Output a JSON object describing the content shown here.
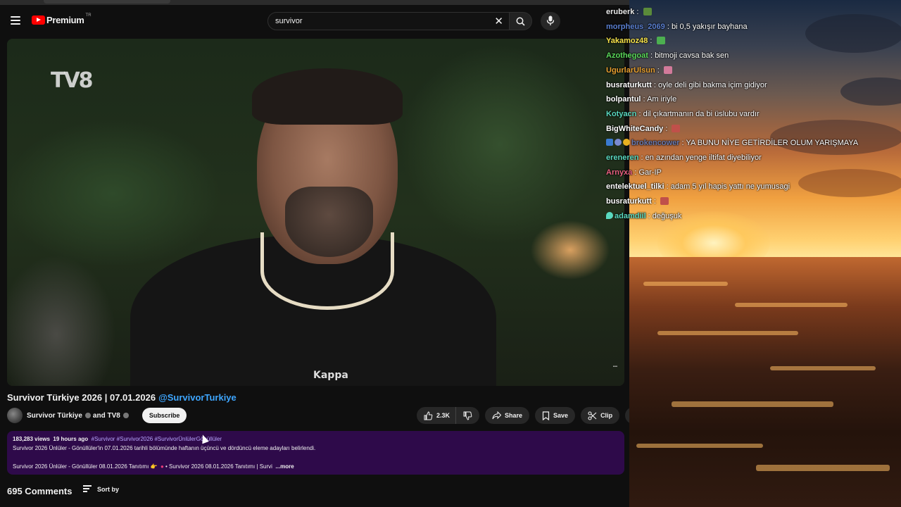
{
  "masthead": {
    "menu_icon": "hamburger-menu-icon",
    "logo_text": "Premium",
    "logo_region": "TR",
    "search_value": "survivor",
    "search_clear_icon": "close-icon",
    "search_icon": "search-icon",
    "mic_icon": "microphone-icon"
  },
  "player": {
    "watermark": "TV8",
    "shirt_logo": "Kappa"
  },
  "video": {
    "title": "Survivor Türkiye 2026 | 07.01.2026",
    "title_handle": "@SurvivorTurkiye",
    "channel": "Survivor Türkiye",
    "channel_and": "and TV8",
    "subscribe_label": "Subscribe",
    "likes": "2.3K",
    "share_label": "Share",
    "save_label": "Save",
    "clip_label": "Clip"
  },
  "description": {
    "views": "183,283 views",
    "age": "19 hours ago",
    "tags": "#Survivor #Survivor2026 #SurvivorÜnlülerGönüllüler",
    "line2": "Survivor 2026 Ünlüler - Gönüllüler'in 07.01.2026 tarihli bölümünde haftanın üçüncü ve dördüncü eleme adayları belirlendi.",
    "line3a": "Survivor 2026 Ünlüler - Gönüllüler 08.01.2026 Tanıtımı 👉",
    "line3b": "• Survivor 2026 08.01.2026 Tanıtımı | Survi",
    "more_label": "...more"
  },
  "comments": {
    "count_label": "695 Comments",
    "sort_label": "Sort by"
  },
  "chat": [
    {
      "user": "eruberk",
      "color": "#e8e8e8",
      "text": "",
      "emote": "#5a8a3a"
    },
    {
      "user": "morpheus_2069",
      "color": "#5a7fd0",
      "text": "bi 0,5 yakışır bayhana"
    },
    {
      "user": "Yakamoz48",
      "color": "#f7e34a",
      "text": "",
      "emote": "#4caf50"
    },
    {
      "user": "Azothegoat",
      "color": "#5ad95a",
      "text": "bitmoji cavsa bak sen"
    },
    {
      "user": "UgurlarUlsun",
      "color": "#e8a030",
      "text": "",
      "emote": "#d27a9a"
    },
    {
      "user": "busraturkutt",
      "color": "#ffffff",
      "text": "oyle deli gibi bakma içim gidiyor"
    },
    {
      "user": "bolpantul",
      "color": "#ffffff",
      "text": "Am iriyle"
    },
    {
      "user": "Kotyacn",
      "color": "#5ad9c0",
      "text": "dil çıkartmanın da bi üslubu vardır"
    },
    {
      "user": "BigWhiteCandy",
      "color": "#ffffff",
      "text": "",
      "emote": "#c0504a"
    },
    {
      "user": "brokencower",
      "color": "#6a7ab0",
      "text": "YA BUNU NİYE GETİRDİLER OLUM YARIŞMAYA",
      "badges": true
    },
    {
      "user": "ereneren",
      "color": "#5ad9c0",
      "text": "en azından yenge iltifat diyebiliyor"
    },
    {
      "user": "Arnyxa",
      "color": "#e86080",
      "text": "Gar-IP"
    },
    {
      "user": "entelektuel_tilki",
      "color": "#ffffff",
      "text": "adam 5 yıl hapis yattı ne yumusagi"
    },
    {
      "user": "busraturkutt",
      "color": "#ffffff",
      "text": "",
      "emote": "#c0504a"
    },
    {
      "user": "adamdiil",
      "color": "#5ad9c0",
      "text": "değuşuk",
      "heart": true
    }
  ]
}
